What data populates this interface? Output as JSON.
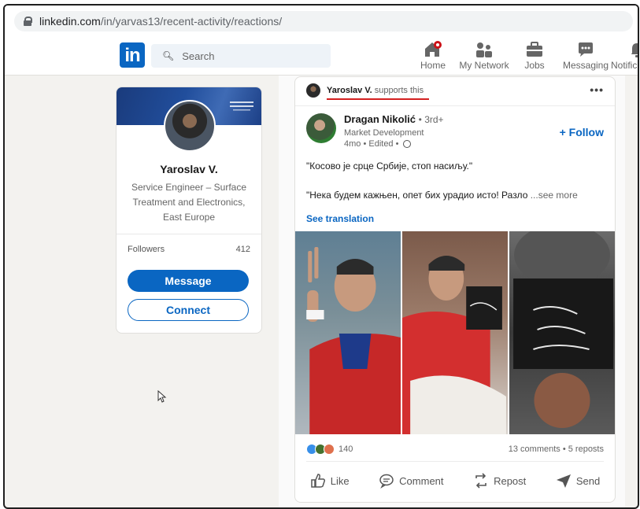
{
  "browser": {
    "url_host": "linkedin.com",
    "url_path": "/in/yarvas13/recent-activity/reactions/"
  },
  "nav": {
    "logo": "in",
    "search_placeholder": "Search",
    "items": [
      {
        "label": "Home",
        "icon": "home-icon"
      },
      {
        "label": "My Network",
        "icon": "network-icon"
      },
      {
        "label": "Jobs",
        "icon": "briefcase-icon"
      },
      {
        "label": "Messaging",
        "icon": "messaging-icon"
      },
      {
        "label": "Notific",
        "icon": "bell-icon"
      }
    ]
  },
  "profile": {
    "name": "Yaroslav V.",
    "headline": "Service Engineer – Surface Treatment and Electronics, East Europe",
    "followers_label": "Followers",
    "followers_count": "412",
    "message_label": "Message",
    "connect_label": "Connect"
  },
  "post": {
    "context_name": "Yaroslav V.",
    "context_action": "supports this",
    "more_label": "•••",
    "author_name": "Dragan Nikolić",
    "author_degree": "• 3rd+",
    "author_headline": "Market Development",
    "post_meta": "4mo • Edited •",
    "follow_label": "+ Follow",
    "text_line1": "\"Косово је срце Србије, стоп насиљу.\"",
    "text_line2": "\"Нека будем кажњен, опет бих урадио исто! Разло",
    "see_more": "...see more",
    "see_translation": "See translation",
    "reaction_count": "140",
    "comments_reposts": "13 comments • 5 reposts",
    "actions": [
      {
        "label": "Like",
        "icon": "like-icon"
      },
      {
        "label": "Comment",
        "icon": "comment-icon"
      },
      {
        "label": "Repost",
        "icon": "repost-icon"
      },
      {
        "label": "Send",
        "icon": "send-icon"
      }
    ]
  },
  "colors": {
    "brand_blue": "#0a66c2",
    "notification_red": "#cc1016",
    "underline_red": "#d42020"
  }
}
